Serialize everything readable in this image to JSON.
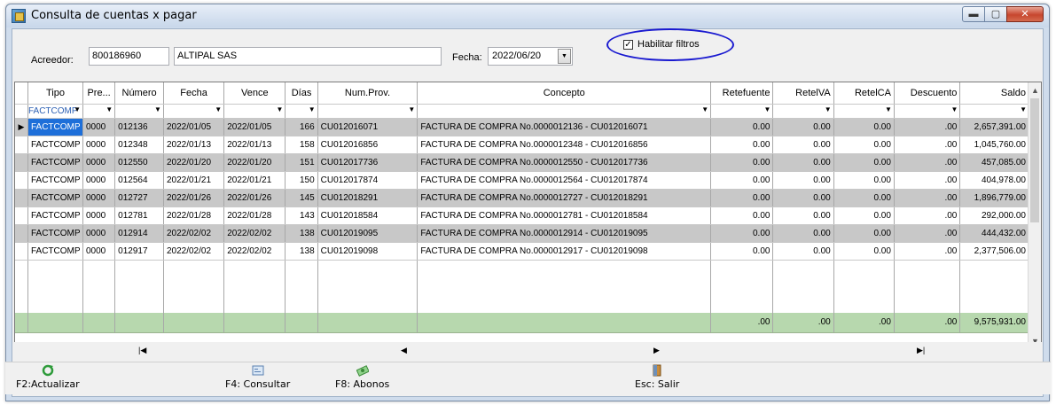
{
  "window": {
    "title": "Consulta de cuentas x pagar"
  },
  "header": {
    "acreedor_label": "Acreedor:",
    "acreedor_code": "800186960",
    "acreedor_name": "ALTIPAL SAS",
    "fecha_label": "Fecha:",
    "fecha_value": "2022/06/20",
    "filtros_label": "Habilitar filtros",
    "filtros_checked": true
  },
  "grid": {
    "columns": [
      "Tipo",
      "Pre...",
      "Número",
      "Fecha",
      "Vence",
      "Días",
      "Num.Prov.",
      "Concepto",
      "Retefuente",
      "RetelVA",
      "RetelCA",
      "Descuento",
      "Saldo"
    ],
    "filter_tipo": "FACTCOMP",
    "rows": [
      [
        "FACTCOMP",
        "0000",
        "012136",
        "2022/01/05",
        "2022/01/05",
        "166",
        "CU012016071",
        "FACTURA DE COMPRA No.0000012136 - CU012016071",
        "0.00",
        "0.00",
        "0.00",
        ".00",
        "2,657,391.00"
      ],
      [
        "FACTCOMP",
        "0000",
        "012348",
        "2022/01/13",
        "2022/01/13",
        "158",
        "CU012016856",
        "FACTURA DE COMPRA No.0000012348 - CU012016856",
        "0.00",
        "0.00",
        "0.00",
        ".00",
        "1,045,760.00"
      ],
      [
        "FACTCOMP",
        "0000",
        "012550",
        "2022/01/20",
        "2022/01/20",
        "151",
        "CU012017736",
        "FACTURA DE COMPRA No.0000012550 - CU012017736",
        "0.00",
        "0.00",
        "0.00",
        ".00",
        "457,085.00"
      ],
      [
        "FACTCOMP",
        "0000",
        "012564",
        "2022/01/21",
        "2022/01/21",
        "150",
        "CU012017874",
        "FACTURA DE COMPRA No.0000012564 - CU012017874",
        "0.00",
        "0.00",
        "0.00",
        ".00",
        "404,978.00"
      ],
      [
        "FACTCOMP",
        "0000",
        "012727",
        "2022/01/26",
        "2022/01/26",
        "145",
        "CU012018291",
        "FACTURA DE COMPRA No.0000012727 - CU012018291",
        "0.00",
        "0.00",
        "0.00",
        ".00",
        "1,896,779.00"
      ],
      [
        "FACTCOMP",
        "0000",
        "012781",
        "2022/01/28",
        "2022/01/28",
        "143",
        "CU012018584",
        "FACTURA DE COMPRA No.0000012781 - CU012018584",
        "0.00",
        "0.00",
        "0.00",
        ".00",
        "292,000.00"
      ],
      [
        "FACTCOMP",
        "0000",
        "012914",
        "2022/02/02",
        "2022/02/02",
        "138",
        "CU012019095",
        "FACTURA DE COMPRA No.0000012914 - CU012019095",
        "0.00",
        "0.00",
        "0.00",
        ".00",
        "444,432.00"
      ],
      [
        "FACTCOMP",
        "0000",
        "012917",
        "2022/02/02",
        "2022/02/02",
        "138",
        "CU012019098",
        "FACTURA DE COMPRA No.0000012917 - CU012019098",
        "0.00",
        "0.00",
        "0.00",
        ".00",
        "2,377,506.00"
      ]
    ],
    "totals": {
      "retefuente": ".00",
      "reteiva": ".00",
      "reteica": ".00",
      "descuento": ".00",
      "saldo": "9,575,931.00"
    }
  },
  "toolbar": {
    "actualizar": "F2:Actualizar",
    "consultar": "F4: Consultar",
    "abonos": "F8: Abonos",
    "salir": "Esc: Salir"
  },
  "colors": {
    "selected": "#1e6fd9",
    "alt_row": "#c8c8c8",
    "totals_row": "#b7d8ae",
    "highlight_circle": "#1a1ad0"
  }
}
